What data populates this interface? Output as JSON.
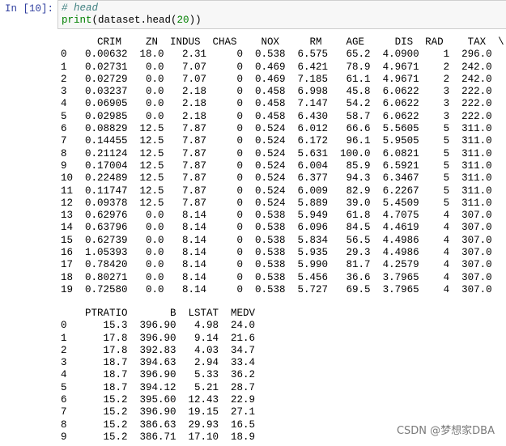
{
  "cell": {
    "prompt": "In  [10]:",
    "code_comment": "# head",
    "code_fn": "print",
    "code_open": "(dataset.head(",
    "code_arg": "20",
    "code_close": "))"
  },
  "output1": "      CRIM    ZN  INDUS  CHAS    NOX     RM    AGE     DIS  RAD    TAX  \\\n0   0.00632  18.0   2.31     0  0.538  6.575   65.2  4.0900    1  296.0\n1   0.02731   0.0   7.07     0  0.469  6.421   78.9  4.9671    2  242.0\n2   0.02729   0.0   7.07     0  0.469  7.185   61.1  4.9671    2  242.0\n3   0.03237   0.0   2.18     0  0.458  6.998   45.8  6.0622    3  222.0\n4   0.06905   0.0   2.18     0  0.458  7.147   54.2  6.0622    3  222.0\n5   0.02985   0.0   2.18     0  0.458  6.430   58.7  6.0622    3  222.0\n6   0.08829  12.5   7.87     0  0.524  6.012   66.6  5.5605    5  311.0\n7   0.14455  12.5   7.87     0  0.524  6.172   96.1  5.9505    5  311.0\n8   0.21124  12.5   7.87     0  0.524  5.631  100.0  6.0821    5  311.0\n9   0.17004  12.5   7.87     0  0.524  6.004   85.9  6.5921    5  311.0\n10  0.22489  12.5   7.87     0  0.524  6.377   94.3  6.3467    5  311.0\n11  0.11747  12.5   7.87     0  0.524  6.009   82.9  6.2267    5  311.0\n12  0.09378  12.5   7.87     0  0.524  5.889   39.0  5.4509    5  311.0\n13  0.62976   0.0   8.14     0  0.538  5.949   61.8  4.7075    4  307.0\n14  0.63796   0.0   8.14     0  0.538  6.096   84.5  4.4619    4  307.0\n15  0.62739   0.0   8.14     0  0.538  5.834   56.5  4.4986    4  307.0\n16  1.05393   0.0   8.14     0  0.538  5.935   29.3  4.4986    4  307.0\n17  0.78420   0.0   8.14     0  0.538  5.990   81.7  4.2579    4  307.0\n18  0.80271   0.0   8.14     0  0.538  5.456   36.6  3.7965    4  307.0\n19  0.72580   0.0   8.14     0  0.538  5.727   69.5  3.7965    4  307.0",
  "output2": "    PTRATIO       B  LSTAT  MEDV\n0      15.3  396.90   4.98  24.0\n1      17.8  396.90   9.14  21.6\n2      17.8  392.83   4.03  34.7\n3      18.7  394.63   2.94  33.4\n4      18.7  396.90   5.33  36.2\n5      18.7  394.12   5.21  28.7\n6      15.2  395.60  12.43  22.9\n7      15.2  396.90  19.15  27.1\n8      15.2  386.63  29.93  16.5\n9      15.2  386.71  17.10  18.9",
  "watermark": "CSDN @梦想家DBA"
}
